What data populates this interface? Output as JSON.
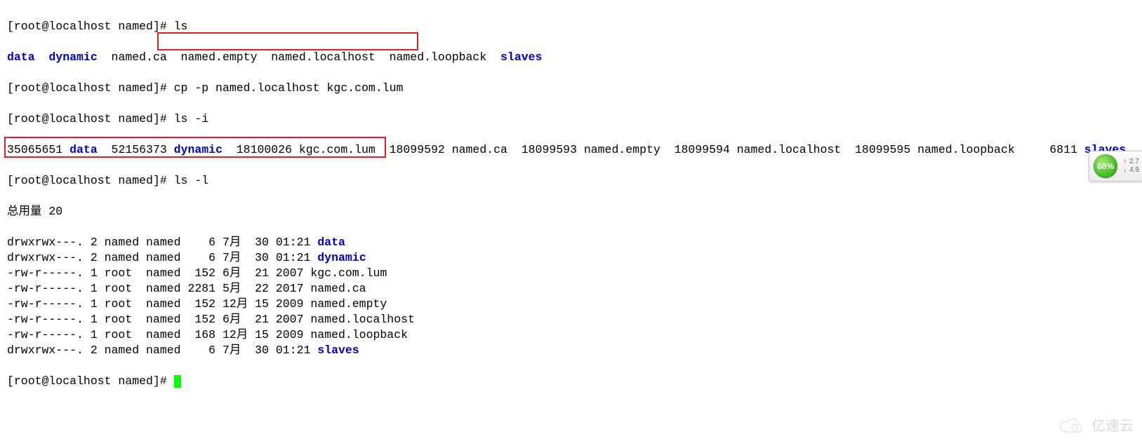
{
  "prompt": "[root@localhost named]# ",
  "cmds": {
    "ls": "ls",
    "cp": "cp -p named.localhost kgc.com.lum",
    "lsi": "ls -i",
    "lsl": "ls -l"
  },
  "ls_plain": {
    "dirs1": "data  dynamic",
    "files1": "  named.ca  named.empty  named.localhost  named.loopback  ",
    "dirs2": "slaves"
  },
  "ls_i": {
    "i1": "35065651 ",
    "d1": "data",
    "i2": "  52156373 ",
    "d2": "dynamic",
    "rest": "  18100026 kgc.com.lum  18099592 named.ca  18099593 named.empty  18099594 named.localhost  18099595 named.loopback     6811 ",
    "d3": "slaves"
  },
  "total": "总用量 20",
  "rows": [
    {
      "meta": "drwxrwx---. 2 named named    6 7月  30 01:21 ",
      "name": "data",
      "dir": true
    },
    {
      "meta": "drwxrwx---. 2 named named    6 7月  30 01:21 ",
      "name": "dynamic",
      "dir": true
    },
    {
      "meta": "-rw-r-----. 1 root  named  152 6月  21 2007 ",
      "name": "kgc.com.lum",
      "dir": false
    },
    {
      "meta": "-rw-r-----. 1 root  named 2281 5月  22 2017 ",
      "name": "named.ca",
      "dir": false
    },
    {
      "meta": "-rw-r-----. 1 root  named  152 12月 15 2009 ",
      "name": "named.empty",
      "dir": false
    },
    {
      "meta": "-rw-r-----. 1 root  named  152 6月  21 2007 ",
      "name": "named.localhost",
      "dir": false
    },
    {
      "meta": "-rw-r-----. 1 root  named  168 12月 15 2009 ",
      "name": "named.loopback",
      "dir": false
    },
    {
      "meta": "drwxrwx---. 2 named named    6 7月  30 01:21 ",
      "name": "slaves",
      "dir": true
    }
  ],
  "widget": {
    "percent": "68%",
    "up": "2.7",
    "down": "4.9"
  },
  "watermark": "亿速云"
}
